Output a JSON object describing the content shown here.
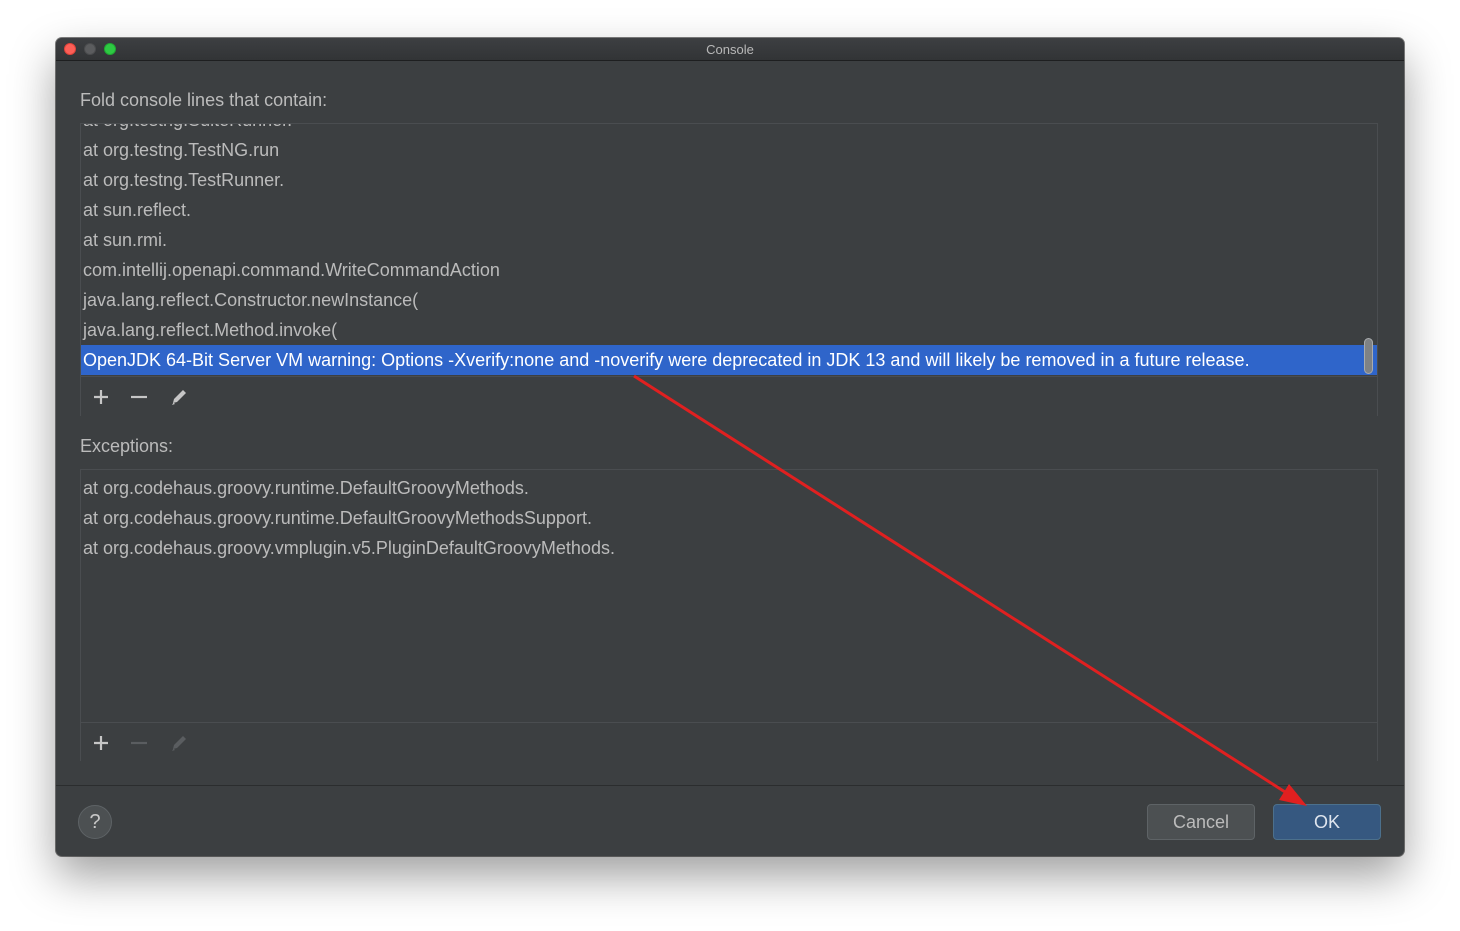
{
  "window": {
    "title": "Console"
  },
  "fold_section": {
    "label": "Fold console lines that contain:",
    "items": [
      "at org.testng.SuiteRunner.",
      "at org.testng.TestNG.run",
      "at org.testng.TestRunner.",
      "at sun.reflect.",
      "at sun.rmi.",
      "com.intellij.openapi.command.WriteCommandAction",
      "java.lang.reflect.Constructor.newInstance(",
      "java.lang.reflect.Method.invoke(",
      "OpenJDK 64-Bit Server VM warning: Options -Xverify:none and -noverify were deprecated in JDK 13 and will likely be removed in a future release."
    ],
    "selected_index": 8
  },
  "exceptions_section": {
    "label": "Exceptions:",
    "items": [
      "at org.codehaus.groovy.runtime.DefaultGroovyMethods.",
      "at org.codehaus.groovy.runtime.DefaultGroovyMethodsSupport.",
      "at org.codehaus.groovy.vmplugin.v5.PluginDefaultGroovyMethods."
    ]
  },
  "footer": {
    "help_label": "?",
    "cancel_label": "Cancel",
    "ok_label": "OK"
  },
  "icons": {
    "add": "plus-icon",
    "remove": "minus-icon",
    "edit": "pencil-icon",
    "help": "question-icon"
  },
  "colors": {
    "selection": "#2f65ca",
    "ok_button": "#365880",
    "annotation_arrow": "#e02020"
  }
}
